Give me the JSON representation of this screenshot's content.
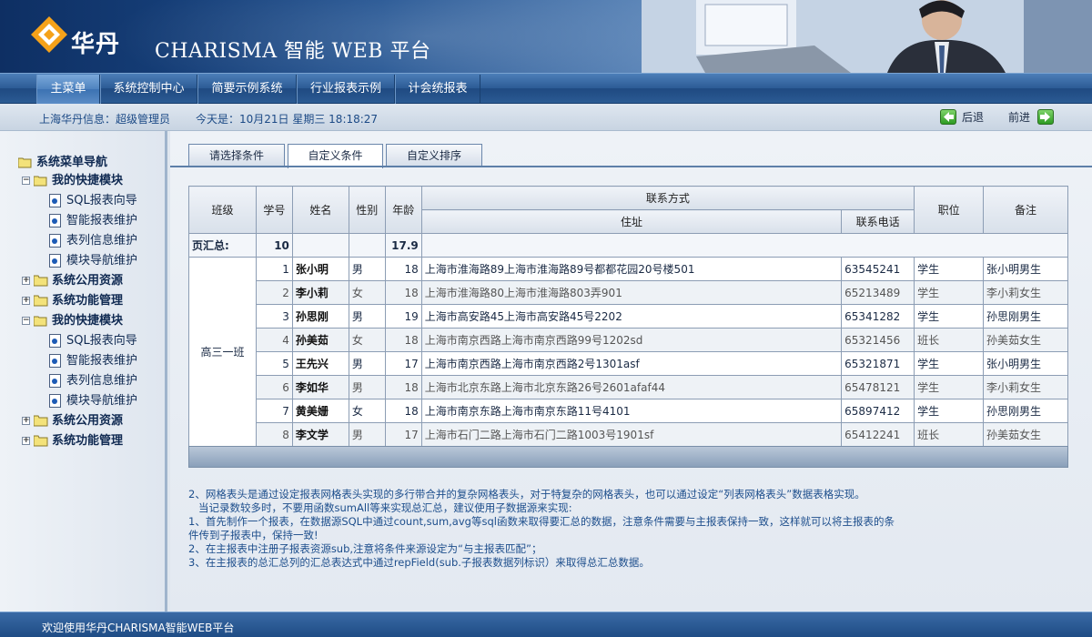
{
  "header": {
    "logo_text": "华丹",
    "brand": "CHARISMA 智能 WEB 平台"
  },
  "nav": {
    "tabs": [
      "主菜单",
      "系统控制中心",
      "简要示例系统",
      "行业报表示例",
      "计会统报表"
    ],
    "active": 0
  },
  "infobar": {
    "user": "上海华丹信息：超级管理员",
    "date": "今天是：10月21日 星期三  18:18:27",
    "back": "后退",
    "forward": "前进"
  },
  "sidebar": {
    "root": "系统菜单导航",
    "groups": [
      {
        "label": "我的快捷模块",
        "items": [
          "SQL报表向导",
          "智能报表维护",
          "表列信息维护",
          "模块导航维护"
        ]
      },
      {
        "label": "系统公用资源"
      },
      {
        "label": "系统功能管理"
      },
      {
        "label": "我的快捷模块",
        "items": [
          "SQL报表向导",
          "智能报表维护",
          "表列信息维护",
          "模块导航维护"
        ]
      },
      {
        "label": "系统公用资源"
      },
      {
        "label": "系统功能管理"
      }
    ]
  },
  "tabs": [
    "请选择条件",
    "自定义条件",
    "自定义排序"
  ],
  "grid": {
    "headers": {
      "class": "班级",
      "no": "学号",
      "name": "姓名",
      "gender": "性别",
      "age": "年龄",
      "contact": "联系方式",
      "address": "住址",
      "phone": "联系电话",
      "position": "职位",
      "remark": "备注"
    },
    "summary": {
      "label": "页汇总:",
      "no": "10",
      "age": "17.9"
    },
    "class_name": "高三一班",
    "rows": [
      {
        "no": "1",
        "name": "张小明",
        "gender": "男",
        "age": "18",
        "address": "上海市淮海路89上海市淮海路89号都都花园20号楼501",
        "phone": "63545241",
        "position": "学生",
        "remark": "张小明男生"
      },
      {
        "no": "2",
        "name": "李小莉",
        "gender": "女",
        "age": "18",
        "address": "上海市淮海路80上海市淮海路803弄901",
        "phone": "65213489",
        "position": "学生",
        "remark": "李小莉女生"
      },
      {
        "no": "3",
        "name": "孙思刚",
        "gender": "男",
        "age": "19",
        "address": "上海市高安路45上海市高安路45号2202",
        "phone": "65341282",
        "position": "学生",
        "remark": "孙思刚男生"
      },
      {
        "no": "4",
        "name": "孙美茹",
        "gender": "女",
        "age": "18",
        "address": "上海市南京西路上海市南京西路99号1202sd",
        "phone": "65321456",
        "position": "班长",
        "remark": "孙美茹女生"
      },
      {
        "no": "5",
        "name": "王先兴",
        "gender": "男",
        "age": "17",
        "address": "上海市南京西路上海市南京西路2号1301asf",
        "phone": "65321871",
        "position": "学生",
        "remark": "张小明男生"
      },
      {
        "no": "6",
        "name": "李如华",
        "gender": "男",
        "age": "18",
        "address": "上海市北京东路上海市北京东路26号2601afaf44",
        "phone": "65478121",
        "position": "学生",
        "remark": "李小莉女生"
      },
      {
        "no": "7",
        "name": "黄美姗",
        "gender": "女",
        "age": "18",
        "address": "上海市南京东路上海市南京东路11号4101",
        "phone": "65897412",
        "position": "学生",
        "remark": "孙思刚男生"
      },
      {
        "no": "8",
        "name": "李文学",
        "gender": "男",
        "age": "17",
        "address": "上海市石门二路上海市石门二路1003号1901sf",
        "phone": "65412241",
        "position": "班长",
        "remark": "孙美茹女生"
      }
    ]
  },
  "notes": [
    "2、网格表头是通过设定报表网格表头实现的多行带合并的复杂网格表头，对于特复杂的网格表头，也可以通过设定“列表网格表头”数据表格实现。",
    "   当记录数较多时，不要用函数sumAll等来实现总汇总，建议使用子数据源来实现:",
    "1、首先制作一个报表，在数据源SQL中通过count,sum,avg等sql函数来取得要汇总的数据，注意条件需要与主报表保持一致，这样就可以将主报表的条",
    "件传到子报表中，保持一致!",
    "2、在主报表中注册子报表资源sub,注意将条件来源设定为“与主报表匹配”；",
    "3、在主报表的总汇总列的汇总表达式中通过repField(sub.子报表数据列标识）来取得总汇总数据。"
  ],
  "footer": "欢迎使用华丹CHARISMA智能WEB平台",
  "colors": {
    "nav_dark": "#1f4a81",
    "nav_active": "#4f83bf",
    "link_blue": "#1d4e8c",
    "grid_border": "#8c9db4"
  }
}
